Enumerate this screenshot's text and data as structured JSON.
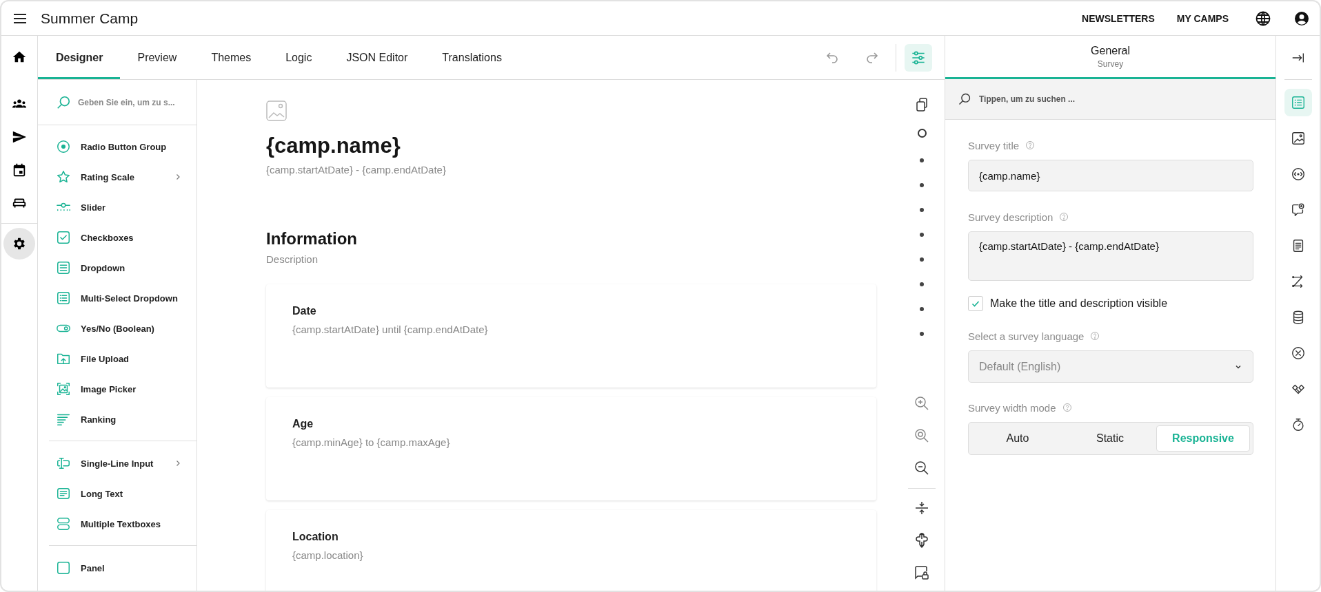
{
  "app_bar": {
    "title": "Summer Camp",
    "links": [
      "NEWSLETTERS",
      "MY CAMPS"
    ]
  },
  "nav_rail": [
    {
      "kind": "home",
      "selected": false
    },
    {
      "kind": "people",
      "selected": false
    },
    {
      "kind": "send",
      "selected": false
    },
    {
      "kind": "calendar",
      "selected": false
    },
    {
      "kind": "bed",
      "selected": false
    },
    {
      "kind": "settings",
      "selected": true
    }
  ],
  "designer_tabs": [
    {
      "label": "Designer",
      "selected": true
    },
    {
      "label": "Preview",
      "selected": false
    },
    {
      "label": "Themes",
      "selected": false
    },
    {
      "label": "Logic",
      "selected": false
    },
    {
      "label": "JSON Editor",
      "selected": false
    },
    {
      "label": "Translations",
      "selected": false
    }
  ],
  "toolbar": {
    "settings_selected": true
  },
  "toolbox": {
    "search_placeholder": "Geben Sie ein, um zu s...",
    "groups": [
      [
        {
          "label": "Radio Button Group",
          "kind": "radio",
          "has_submenu": false
        },
        {
          "label": "Rating Scale",
          "kind": "rating",
          "has_submenu": true
        },
        {
          "label": "Slider",
          "kind": "slider",
          "has_submenu": false
        },
        {
          "label": "Checkboxes",
          "kind": "checkbox",
          "has_submenu": false
        },
        {
          "label": "Dropdown",
          "kind": "dropdown",
          "has_submenu": false
        },
        {
          "label": "Multi-Select Dropdown",
          "kind": "multiselect",
          "has_submenu": false
        },
        {
          "label": "Yes/No (Boolean)",
          "kind": "boolean",
          "has_submenu": false
        },
        {
          "label": "File Upload",
          "kind": "file",
          "has_submenu": false
        },
        {
          "label": "Image Picker",
          "kind": "image",
          "has_submenu": false
        },
        {
          "label": "Ranking",
          "kind": "ranking",
          "has_submenu": false
        }
      ],
      [
        {
          "label": "Single-Line Input",
          "kind": "text",
          "has_submenu": true
        },
        {
          "label": "Long Text",
          "kind": "comment",
          "has_submenu": false
        },
        {
          "label": "Multiple Textboxes",
          "kind": "multitext",
          "has_submenu": false
        }
      ],
      [
        {
          "label": "Panel",
          "kind": "panel",
          "has_submenu": false
        }
      ]
    ]
  },
  "survey": {
    "title": "{camp.name}",
    "description": "{camp.startAtDate} - {camp.endAtDate}",
    "page": {
      "title": "Information",
      "description": "Description",
      "questions": [
        {
          "title": "Date",
          "description": "{camp.startAtDate} until {camp.endAtDate}"
        },
        {
          "title": "Age",
          "description": "{camp.minAge} to {camp.maxAge}"
        },
        {
          "title": "Location",
          "description": "{camp.location}"
        }
      ]
    }
  },
  "page_navigator": [
    {
      "selected": true
    },
    {
      "selected": false
    },
    {
      "selected": false
    },
    {
      "selected": false
    },
    {
      "selected": false
    },
    {
      "selected": false
    },
    {
      "selected": false
    },
    {
      "selected": false
    },
    {
      "selected": false
    }
  ],
  "properties": {
    "tab": {
      "title": "General",
      "subtitle": "Survey"
    },
    "search_placeholder": "Tippen, um zu suchen ...",
    "survey_title": {
      "label": "Survey title",
      "value": "{camp.name}"
    },
    "survey_description": {
      "label": "Survey description",
      "value": "{camp.startAtDate} - {camp.endAtDate}"
    },
    "visible_checkbox": {
      "label": "Make the title and description visible",
      "checked": true
    },
    "language": {
      "label": "Select a survey language",
      "value": "Default (English)"
    },
    "width_mode": {
      "label": "Survey width mode",
      "options": [
        {
          "label": "Auto",
          "selected": false
        },
        {
          "label": "Static",
          "selected": false
        },
        {
          "label": "Responsive",
          "selected": true
        }
      ]
    }
  },
  "side_tabs": [
    {
      "kind": "list",
      "selected": true
    },
    {
      "kind": "image",
      "selected": false
    },
    {
      "kind": "eye",
      "selected": false
    },
    {
      "kind": "chat",
      "selected": false
    },
    {
      "kind": "doc",
      "selected": false
    },
    {
      "kind": "shuffle",
      "selected": false
    },
    {
      "kind": "database",
      "selected": false
    },
    {
      "kind": "cancel",
      "selected": false
    },
    {
      "kind": "handshake",
      "selected": false
    },
    {
      "kind": "timer",
      "selected": false
    }
  ]
}
